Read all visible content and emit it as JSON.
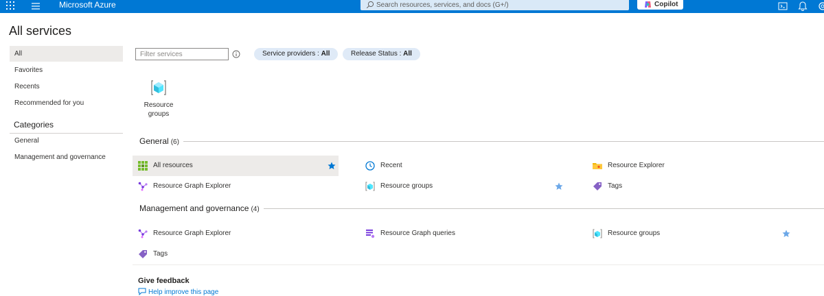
{
  "topbar": {
    "brand": "Microsoft Azure",
    "search_placeholder": "Search resources, services, and docs (G+/)",
    "copilot_label": "Copilot"
  },
  "page": {
    "title": "All services"
  },
  "nav": {
    "items": [
      {
        "label": "All",
        "selected": true
      },
      {
        "label": "Favorites"
      },
      {
        "label": "Recents"
      },
      {
        "label": "Recommended for you"
      }
    ],
    "categories_title": "Categories",
    "categories": [
      {
        "label": "General"
      },
      {
        "label": "Management and governance"
      }
    ]
  },
  "filters": {
    "placeholder": "Filter services",
    "providers_label": "Service providers : ",
    "providers_value": "All",
    "release_label": "Release Status : ",
    "release_value": "All"
  },
  "tile": {
    "label": "Resource groups"
  },
  "general": {
    "title": "General",
    "count": "(6)",
    "items": [
      {
        "label": "All resources",
        "icon": "all-resources-icon",
        "starred": true
      },
      {
        "label": "Recent",
        "icon": "clock-icon"
      },
      {
        "label": "Resource Explorer",
        "icon": "folder-icon"
      },
      {
        "label": "Resource Graph Explorer",
        "icon": "graph-icon"
      },
      {
        "label": "Resource groups",
        "icon": "resource-group-icon",
        "starred": true
      },
      {
        "label": "Tags",
        "icon": "tag-icon"
      }
    ]
  },
  "management": {
    "title": "Management and governance",
    "count": "(4)",
    "items": [
      {
        "label": "Resource Graph Explorer",
        "icon": "graph-icon"
      },
      {
        "label": "Resource Graph queries",
        "icon": "query-icon"
      },
      {
        "label": "Resource groups",
        "icon": "resource-group-icon",
        "starred": true
      },
      {
        "label": "Tags",
        "icon": "tag-icon"
      }
    ]
  },
  "feedback": {
    "title": "Give feedback",
    "link": "Help improve this page"
  },
  "colors": {
    "brand": "#0078d4",
    "star": "#0078d4",
    "pill": "#dfeaf7"
  }
}
